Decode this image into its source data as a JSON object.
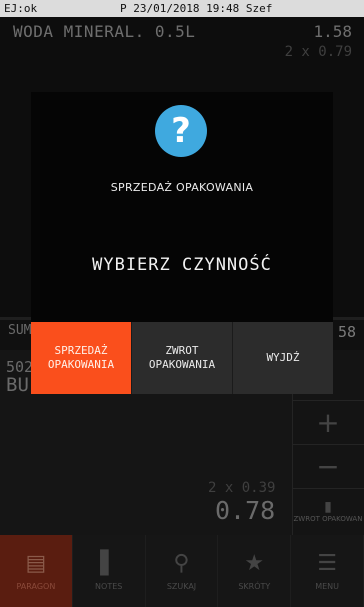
{
  "status": {
    "left": "EJ:ok",
    "center": "P 23/01/2018 19:48 Szef"
  },
  "receipt": {
    "item_name": "WODA MINERAL. 0.5L",
    "item_price": "1.58",
    "item_qty": "2 x 0.79",
    "sum_label": "SUM",
    "sum_value": "58",
    "code_partial": "502",
    "name_partial": "BU",
    "multi_qty": "2 x 0.39",
    "total": "0.78"
  },
  "side": {
    "plus": "+",
    "minus": "−",
    "zwrot_label": "ZWROT OPAKOWAN"
  },
  "nav": [
    {
      "label": "PARAGON",
      "icon": "receipt-icon"
    },
    {
      "label": "NOTES",
      "icon": "notebook-icon"
    },
    {
      "label": "SZUKAJ",
      "icon": "search-icon"
    },
    {
      "label": "SKRÓTY",
      "icon": "star-icon"
    },
    {
      "label": "MENU",
      "icon": "hamburger-icon"
    }
  ],
  "dialog": {
    "icon": "question-icon",
    "icon_glyph": "?",
    "title": "SPRZEDAŻ OPAKOWANIA",
    "message": "WYBIERZ CZYNNOŚĆ",
    "buttons": [
      {
        "line1": "SPRZEDAŻ",
        "line2": "OPAKOWANIA"
      },
      {
        "line1": "ZWROT",
        "line2": "OPAKOWANIA"
      },
      {
        "line1": "WYJDŹ",
        "line2": ""
      }
    ],
    "accent": "#fa4f1c",
    "icon_color": "#3fa9df"
  }
}
